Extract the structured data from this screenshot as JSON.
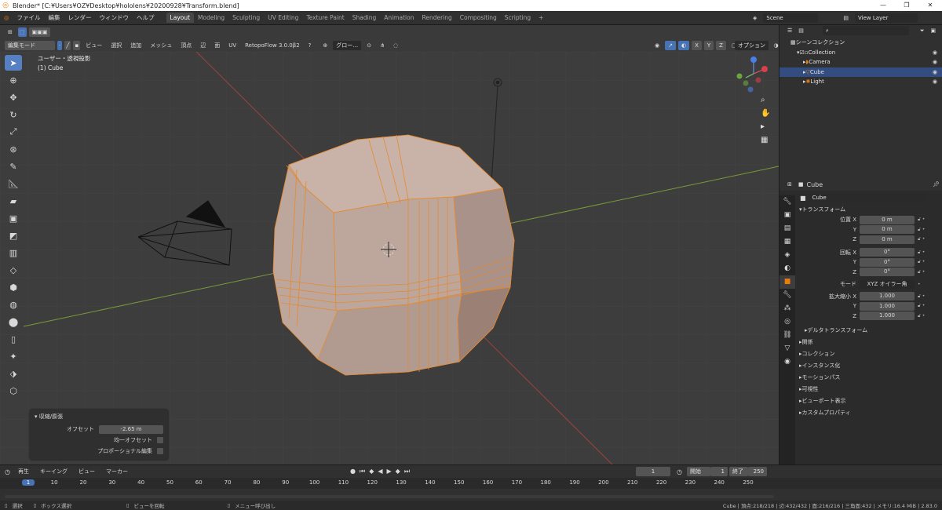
{
  "titlebar": {
    "title": "Blender* [C:¥Users¥OZ¥Desktop¥hololens¥20200928¥Transform.blend]",
    "minimize": "—",
    "maximize": "❐",
    "close": "✕"
  },
  "menu": {
    "items": [
      "ファイル",
      "編集",
      "レンダー",
      "ウィンドウ",
      "ヘルプ"
    ]
  },
  "workspaces": [
    {
      "label": "Layout",
      "active": true
    },
    {
      "label": "Modeling"
    },
    {
      "label": "Sculpting"
    },
    {
      "label": "UV Editing"
    },
    {
      "label": "Texture Paint"
    },
    {
      "label": "Shading"
    },
    {
      "label": "Animation"
    },
    {
      "label": "Rendering"
    },
    {
      "label": "Compositing"
    },
    {
      "label": "Scripting"
    }
  ],
  "add_workspace": "+",
  "scene": {
    "label": "Scene",
    "view_layer": "View Layer"
  },
  "header": {
    "mode": "編集モード",
    "menus": [
      "ビュー",
      "選択",
      "追加",
      "メッシュ",
      "頂点",
      "辺",
      "面",
      "UV"
    ],
    "addon": "RetopoFlow 3.0.0β2",
    "transform": "グロー…",
    "axes": [
      "X",
      "Y",
      "Z"
    ],
    "options": "オプション"
  },
  "viewport": {
    "view_name": "ユーザー・透視投影",
    "object_name": "(1) Cube"
  },
  "tools": [
    "cursor-arrow",
    "cursor",
    "move",
    "rotate",
    "scale",
    "transform",
    "annotate",
    "measure",
    "extrude",
    "inset",
    "bevel",
    "loopcut",
    "knife",
    "polybuild",
    "spin",
    "smooth",
    "shrink",
    "shear",
    "rip",
    "cube"
  ],
  "operator": {
    "title": "収縮/膨張",
    "offset_label": "オフセット",
    "offset_value": "-2.65 m",
    "even_label": "均一オフセット",
    "prop_label": "プロポーショナル編集"
  },
  "outliner": {
    "root": "シーンコレクション",
    "collection": "Collection",
    "items": [
      {
        "name": "Camera"
      },
      {
        "name": "Cube",
        "selected": true
      },
      {
        "name": "Light"
      }
    ]
  },
  "properties": {
    "header": "Cube",
    "object_field": "Cube",
    "transform_title": "トランスフォーム",
    "location": {
      "label": "位置 X",
      "x": "0 m",
      "y": "0 m",
      "z": "0 m"
    },
    "rotation": {
      "label": "回転 X",
      "x": "0°",
      "y": "0°",
      "z": "0°"
    },
    "mode": {
      "label": "モード",
      "value": "XYZ オイラー角"
    },
    "scale": {
      "label": "拡大縮小 X",
      "x": "1.000",
      "y": "1.000",
      "z": "1.000"
    },
    "axis_y": "Y",
    "axis_z": "Z",
    "sections": [
      "デルタトランスフォーム",
      "関係",
      "コレクション",
      "インスタンス化",
      "モーションパス",
      "可視性",
      "ビューポート表示",
      "カスタムプロパティ"
    ]
  },
  "timeline": {
    "menus": [
      "再生",
      "キーイング",
      "ビュー",
      "マーカー"
    ],
    "current_frame": "1",
    "start_label": "開始",
    "start": "1",
    "end_label": "終了",
    "end": "250",
    "ticks": [
      "1",
      "10",
      "20",
      "30",
      "40",
      "50",
      "60",
      "70",
      "80",
      "90",
      "100",
      "110",
      "120",
      "130",
      "140",
      "150",
      "160",
      "170",
      "180",
      "190",
      "200",
      "210",
      "220",
      "230",
      "240",
      "250"
    ]
  },
  "status": {
    "select": "選択",
    "box": "ボックス選択",
    "rotate": "ビューを回転",
    "menu": "メニュー呼び出し",
    "stats": "Cube | 頂点:218/218 | 辺:432/432 | 面:216/216 | 三角面:432 | メモリ:16.4 MiB | 2.83.0"
  },
  "colors": {
    "accent": "#e87d0d",
    "selection": "#4772b3",
    "viewport_bg": "#3d3d3d",
    "mesh_face": "#b6a096"
  }
}
